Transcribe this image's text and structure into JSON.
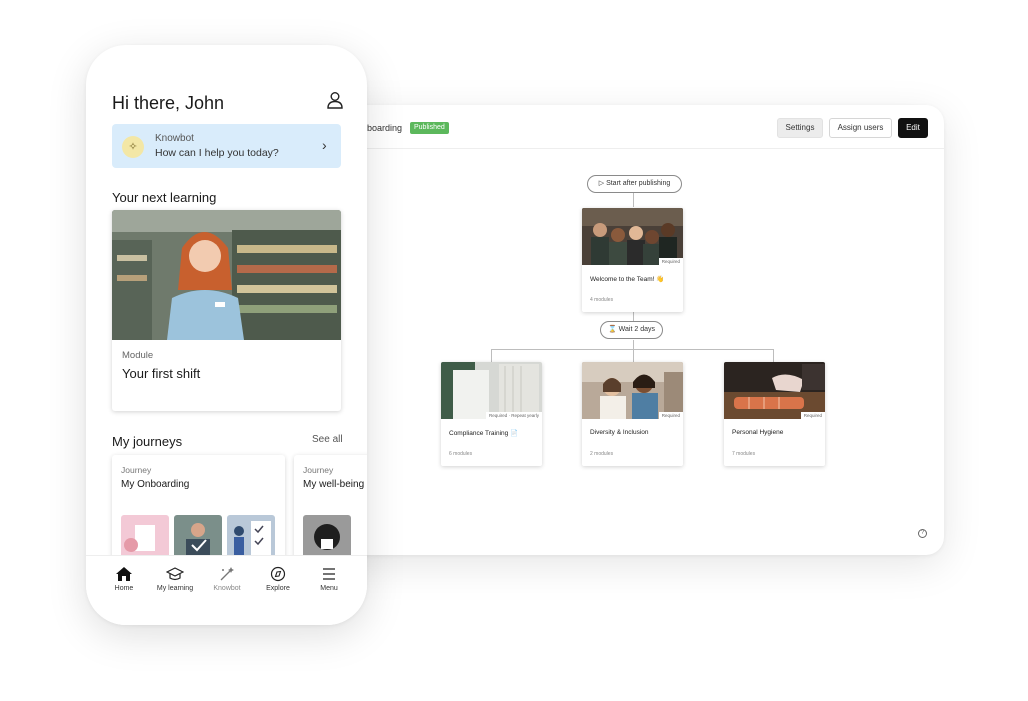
{
  "desktop": {
    "title": "Onboarding",
    "status": "Published",
    "buttons": {
      "settings": "Settings",
      "assign_users": "Assign users",
      "edit": "Edit"
    },
    "flow": {
      "start": "Start after publishing",
      "wait": "Wait 2 days",
      "top_node": {
        "title": "Welcome to the Team! 👋",
        "tag": "Required",
        "modules": "4 modules"
      },
      "nodes": [
        {
          "title": "Compliance Training 📄",
          "tag": "Required · Repeat yearly",
          "modules": "6 modules"
        },
        {
          "title": "Diversity & Inclusion",
          "tag": "Required",
          "modules": "2 modules"
        },
        {
          "title": "Personal Hygiene",
          "tag": "Required",
          "modules": "7 modules"
        }
      ]
    },
    "icons": {
      "play": "play-icon",
      "hourglass": "hourglass-icon",
      "help": "help-icon"
    }
  },
  "phone": {
    "greeting": "Hi there, John",
    "knowbot": {
      "title": "Knowbot",
      "subtitle": "How can I help you today?"
    },
    "next_learning": {
      "heading": "Your next learning",
      "type": "Module",
      "title": "Your first shift"
    },
    "journeys": {
      "heading": "My journeys",
      "see_all": "See all",
      "items": [
        {
          "type": "Journey",
          "title": "My Onboarding"
        },
        {
          "type": "Journey",
          "title": "My well-being"
        }
      ]
    },
    "nav": [
      {
        "label": "Home",
        "icon": "home-icon"
      },
      {
        "label": "My learning",
        "icon": "graduation-cap-icon"
      },
      {
        "label": "Knowbot",
        "icon": "magic-wand-icon"
      },
      {
        "label": "Explore",
        "icon": "compass-icon"
      },
      {
        "label": "Menu",
        "icon": "menu-icon"
      }
    ]
  },
  "colors": {
    "published": "#5cb85c",
    "knowbot_bg": "#d9ecfb",
    "primary_dark": "#111111"
  }
}
